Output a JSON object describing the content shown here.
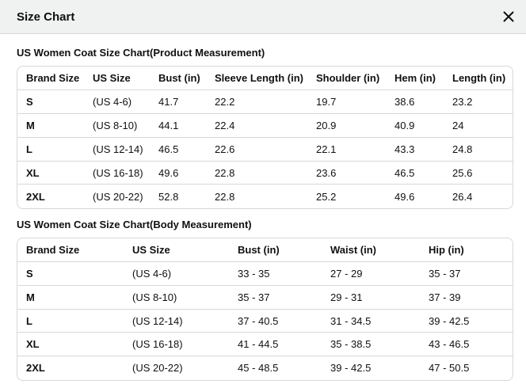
{
  "dialog": {
    "title": "Size Chart",
    "close_icon": "close-icon"
  },
  "product_table": {
    "title": "US Women Coat Size Chart(Product Measurement)",
    "columns": [
      "Brand Size",
      "US Size",
      "Bust (in)",
      "Sleeve Length (in)",
      "Shoulder (in)",
      "Hem (in)",
      "Length (in)"
    ],
    "rows": [
      [
        "S",
        "(US 4-6)",
        "41.7",
        "22.2",
        "19.7",
        "38.6",
        "23.2"
      ],
      [
        "M",
        "(US 8-10)",
        "44.1",
        "22.4",
        "20.9",
        "40.9",
        "24"
      ],
      [
        "L",
        "(US 12-14)",
        "46.5",
        "22.6",
        "22.1",
        "43.3",
        "24.8"
      ],
      [
        "XL",
        "(US 16-18)",
        "49.6",
        "22.8",
        "23.6",
        "46.5",
        "25.6"
      ],
      [
        "2XL",
        "(US 20-22)",
        "52.8",
        "22.8",
        "25.2",
        "49.6",
        "26.4"
      ]
    ]
  },
  "body_table": {
    "title": "US Women Coat Size Chart(Body Measurement)",
    "columns": [
      "Brand Size",
      "US Size",
      "Bust (in)",
      "Waist (in)",
      "Hip (in)"
    ],
    "rows": [
      [
        "S",
        "(US 4-6)",
        "33 - 35",
        "27 - 29",
        "35 - 37"
      ],
      [
        "M",
        "(US 8-10)",
        "35 - 37",
        "29 - 31",
        "37 - 39"
      ],
      [
        "L",
        "(US 12-14)",
        "37 - 40.5",
        "31 - 34.5",
        "39 - 42.5"
      ],
      [
        "XL",
        "(US 16-18)",
        "41 - 44.5",
        "35 - 38.5",
        "43 - 46.5"
      ],
      [
        "2XL",
        "(US 20-22)",
        "45 - 48.5",
        "39 - 42.5",
        "47 - 50.5"
      ]
    ]
  },
  "colors": {
    "header_bg": "#f0f2f2",
    "border": "#d5d9d9",
    "text": "#0f1111"
  }
}
